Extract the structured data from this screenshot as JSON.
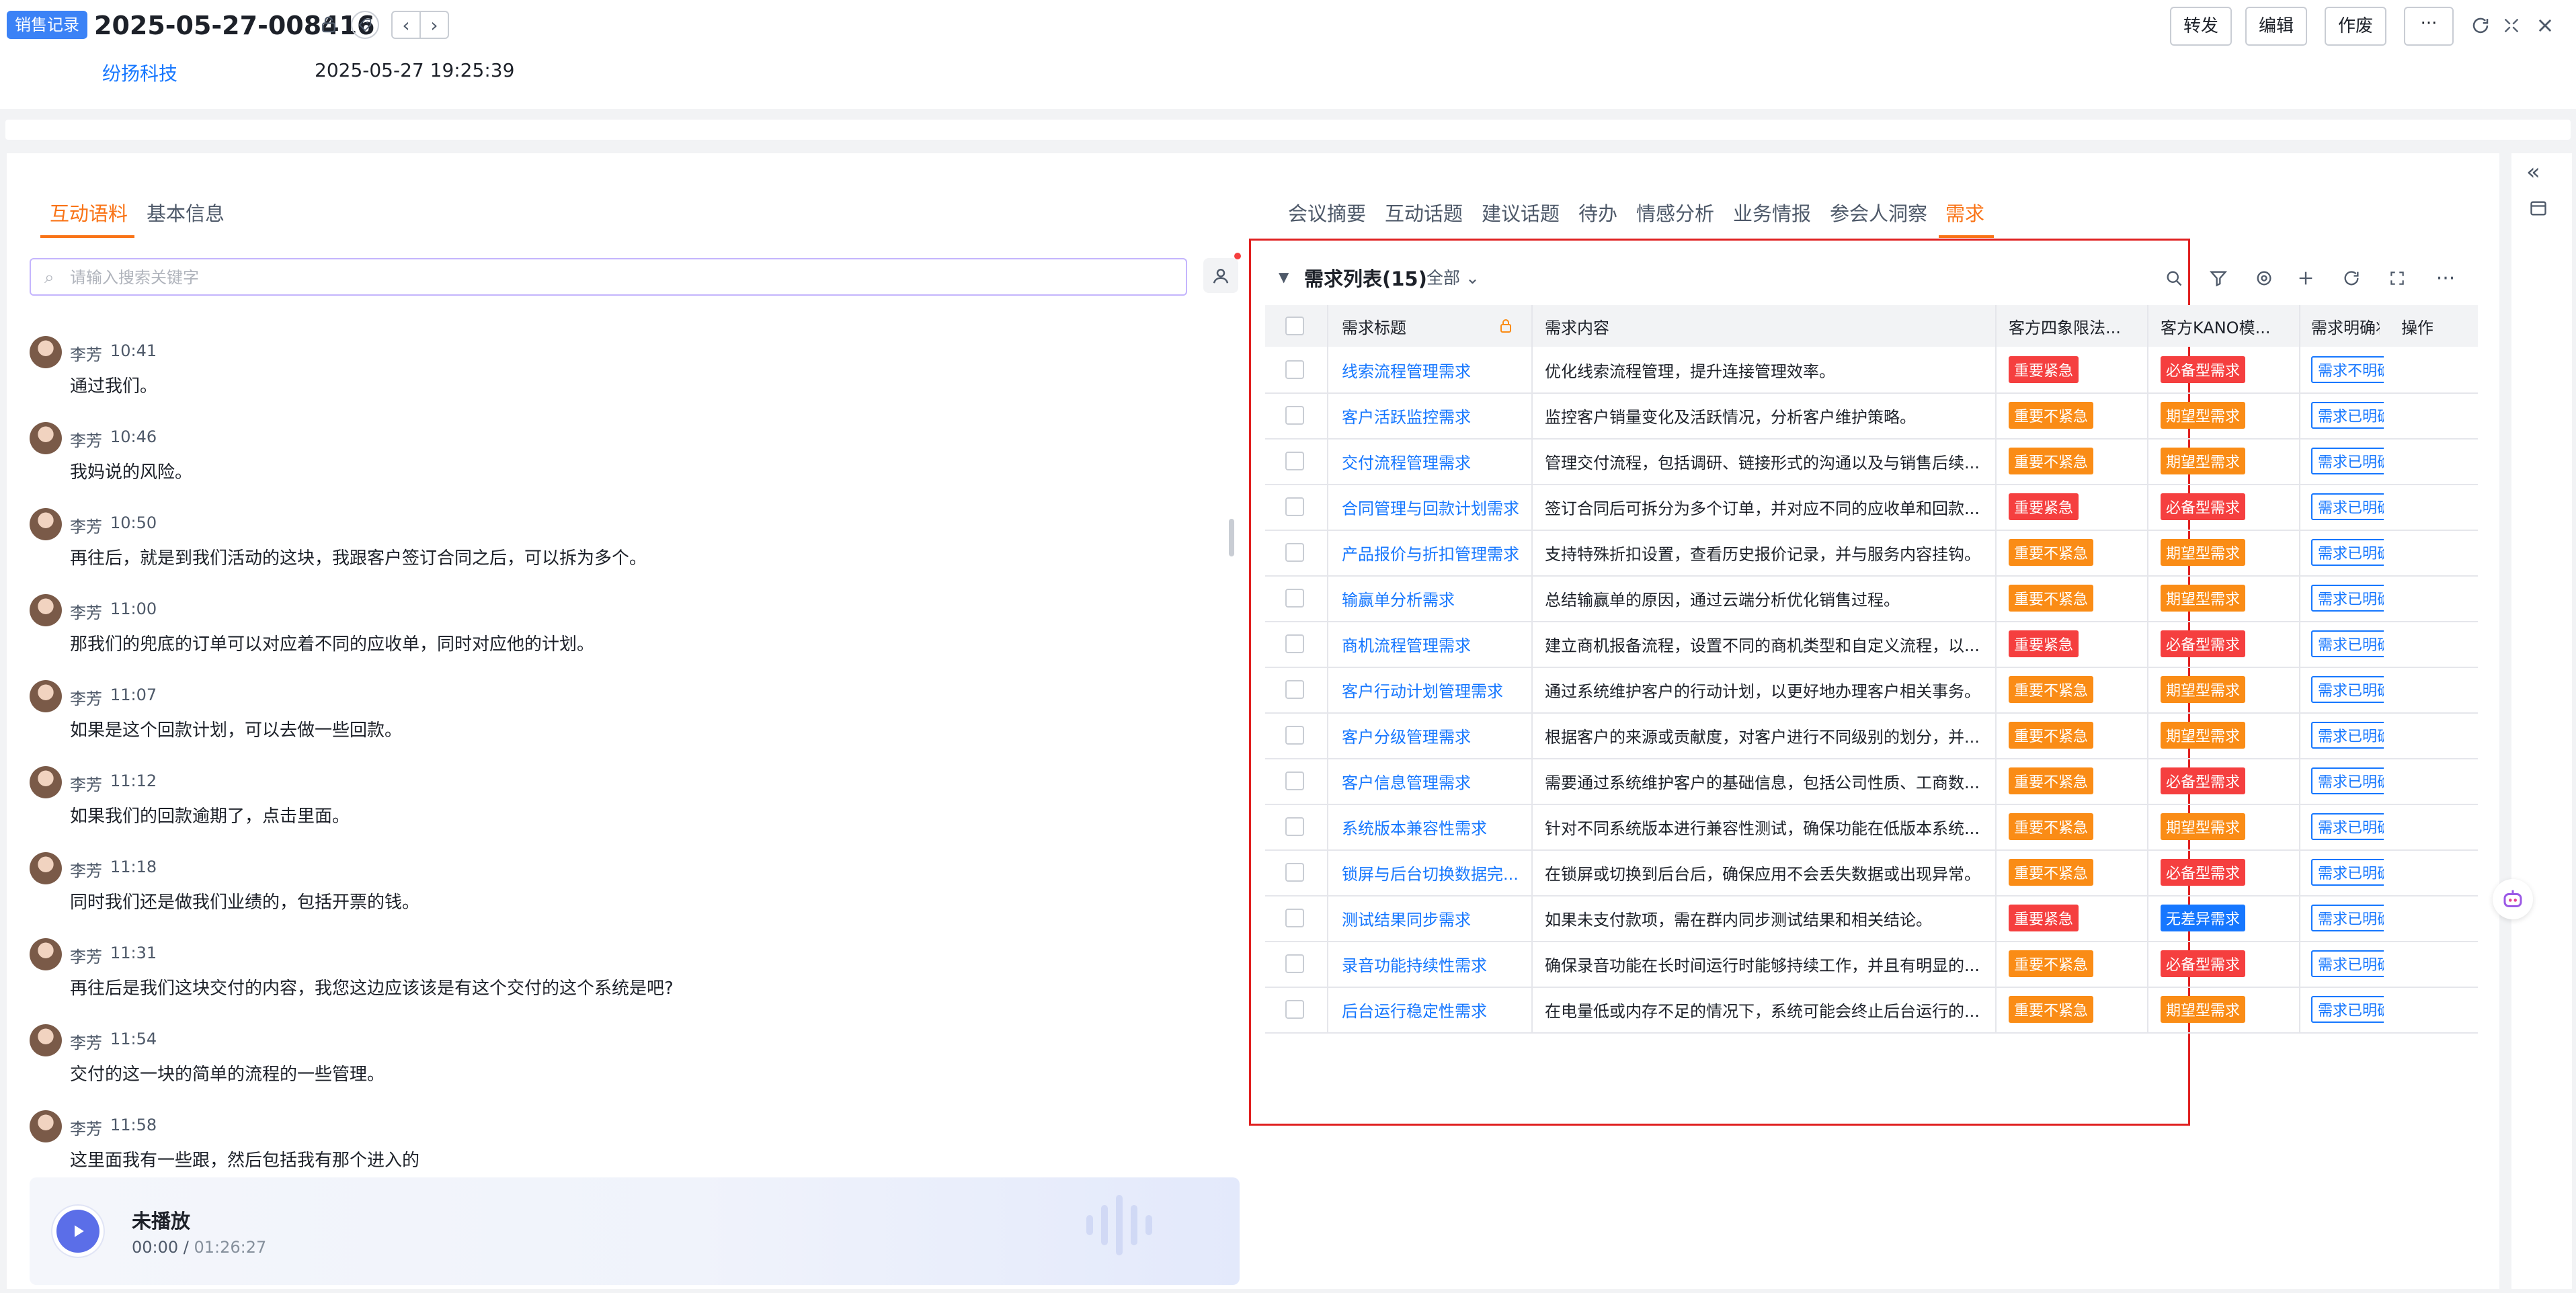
{
  "header": {
    "record_tag": "销售记录",
    "record_id": "2025-05-27-008416",
    "company": "纷扬科技",
    "datetime": "2025-05-27 19:25:39",
    "buttons": {
      "forward": "转发",
      "edit": "编辑",
      "void": "作废",
      "more": "···"
    },
    "icons": [
      "lock-icon",
      "tag-icon",
      "prev-icon",
      "next-icon",
      "refresh-icon",
      "fullscreen-icon",
      "close-icon"
    ]
  },
  "left_tabs": [
    {
      "label": "互动语料",
      "active": true
    },
    {
      "label": "基本信息",
      "active": false
    }
  ],
  "search": {
    "placeholder": "请输入搜索关键字",
    "value": ""
  },
  "messages": [
    {
      "speaker": "李芳",
      "time": "10:41",
      "text": "通过我们。"
    },
    {
      "speaker": "李芳",
      "time": "10:46",
      "text": "我妈说的风险。"
    },
    {
      "speaker": "李芳",
      "time": "10:50",
      "text": "再往后，就是到我们活动的这块，我跟客户签订合同之后，可以拆为多个。"
    },
    {
      "speaker": "李芳",
      "time": "11:00",
      "text": "那我们的兜底的订单可以对应着不同的应收单，同时对应他的计划。"
    },
    {
      "speaker": "李芳",
      "time": "11:07",
      "text": "如果是这个回款计划，可以去做一些回款。"
    },
    {
      "speaker": "李芳",
      "time": "11:12",
      "text": "如果我们的回款逾期了，点击里面。"
    },
    {
      "speaker": "李芳",
      "time": "11:18",
      "text": "同时我们还是做我们业绩的，包括开票的钱。"
    },
    {
      "speaker": "李芳",
      "time": "11:31",
      "text": "再往后是我们这块交付的内容，我您这边应该该是有这个交付的这个系统是吧?"
    },
    {
      "speaker": "李芳",
      "time": "11:54",
      "text": "交付的这一块的简单的流程的一些管理。"
    },
    {
      "speaker": "李芳",
      "time": "11:58",
      "text": "这里面我有一些跟，然后包括我有那个进入的"
    }
  ],
  "player": {
    "status": "未播放",
    "current": "00:00",
    "separator": " / ",
    "total": "01:26:27"
  },
  "right_tabs": [
    {
      "label": "会议摘要",
      "active": false
    },
    {
      "label": "互动话题",
      "active": false
    },
    {
      "label": "建议话题",
      "active": false
    },
    {
      "label": "待办",
      "active": false
    },
    {
      "label": "情感分析",
      "active": false
    },
    {
      "label": "业务情报",
      "active": false
    },
    {
      "label": "参会人洞察",
      "active": false
    },
    {
      "label": "需求",
      "active": true
    }
  ],
  "requirements": {
    "title": "需求列表(15)",
    "filter": "全部",
    "columns": [
      "需求标题",
      "需求内容",
      "客方四象限法...",
      "客方KANO模...",
      "需求明确状",
      "操作"
    ],
    "rows": [
      {
        "title": "线索流程管理需求",
        "content": "优化线索流程管理，提升连接管理效率。",
        "quadrant": "重要紧急",
        "kano": "必备型需求",
        "status": "需求不明确"
      },
      {
        "title": "客户活跃监控需求",
        "content": "监控客户销量变化及活跃情况，分析客户维护策略。",
        "quadrant": "重要不紧急",
        "kano": "期望型需求",
        "status": "需求已明确"
      },
      {
        "title": "交付流程管理需求",
        "content": "管理交付流程，包括调研、链接形式的沟通以及与销售后续...",
        "quadrant": "重要不紧急",
        "kano": "期望型需求",
        "status": "需求已明确"
      },
      {
        "title": "合同管理与回款计划需求",
        "content": "签订合同后可拆分为多个订单，并对应不同的应收单和回款...",
        "quadrant": "重要紧急",
        "kano": "必备型需求",
        "status": "需求已明确"
      },
      {
        "title": "产品报价与折扣管理需求",
        "content": "支持特殊折扣设置，查看历史报价记录，并与服务内容挂钩。",
        "quadrant": "重要不紧急",
        "kano": "期望型需求",
        "status": "需求已明确"
      },
      {
        "title": "输赢单分析需求",
        "content": "总结输赢单的原因，通过云端分析优化销售过程。",
        "quadrant": "重要不紧急",
        "kano": "期望型需求",
        "status": "需求已明确"
      },
      {
        "title": "商机流程管理需求",
        "content": "建立商机报备流程，设置不同的商机类型和自定义流程，以...",
        "quadrant": "重要紧急",
        "kano": "必备型需求",
        "status": "需求已明确"
      },
      {
        "title": "客户行动计划管理需求",
        "content": "通过系统维护客户的行动计划，以更好地办理客户相关事务。",
        "quadrant": "重要不紧急",
        "kano": "期望型需求",
        "status": "需求已明确"
      },
      {
        "title": "客户分级管理需求",
        "content": "根据客户的来源或贡献度，对客户进行不同级别的划分，并...",
        "quadrant": "重要不紧急",
        "kano": "期望型需求",
        "status": "需求已明确"
      },
      {
        "title": "客户信息管理需求",
        "content": "需要通过系统维护客户的基础信息，包括公司性质、工商数...",
        "quadrant": "重要不紧急",
        "kano": "必备型需求",
        "status": "需求已明确"
      },
      {
        "title": "系统版本兼容性需求",
        "content": "针对不同系统版本进行兼容性测试，确保功能在低版本系统...",
        "quadrant": "重要不紧急",
        "kano": "期望型需求",
        "status": "需求已明确"
      },
      {
        "title": "锁屏与后台切换数据完...",
        "content": "在锁屏或切换到后台后，确保应用不会丢失数据或出现异常。",
        "quadrant": "重要不紧急",
        "kano": "必备型需求",
        "status": "需求已明确"
      },
      {
        "title": "测试结果同步需求",
        "content": "如果未支付款项，需在群内同步测试结果和相关结论。",
        "quadrant": "重要紧急",
        "kano": "无差异需求",
        "status": "需求已明确"
      },
      {
        "title": "录音功能持续性需求",
        "content": "确保录音功能在长时间运行时能够持续工作，并且有明显的...",
        "quadrant": "重要不紧急",
        "kano": "必备型需求",
        "status": "需求已明确"
      },
      {
        "title": "后台运行稳定性需求",
        "content": "在电量低或内存不足的情况下，系统可能会终止后台运行的...",
        "quadrant": "重要不紧急",
        "kano": "期望型需求",
        "status": "需求已明确"
      }
    ]
  },
  "colors": {
    "accent": "#f97316",
    "link": "#1677ff",
    "urgent": "#f53f3f",
    "non_urgent": "#fa8c16",
    "frame": "#e02020"
  }
}
